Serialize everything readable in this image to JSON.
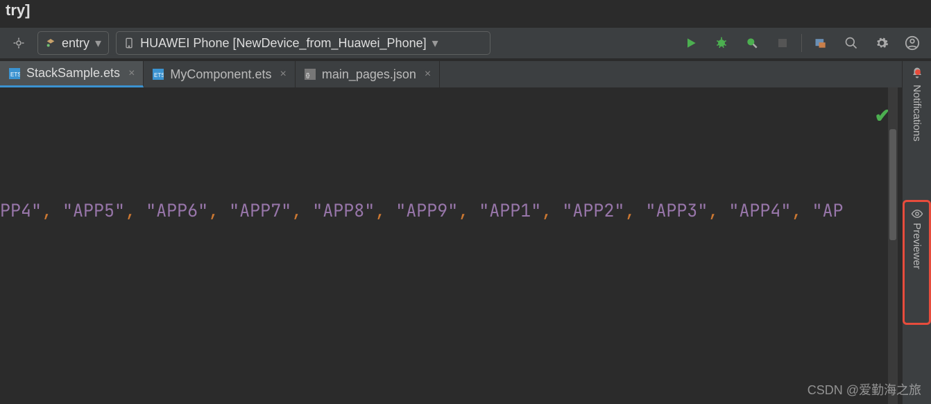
{
  "breadcrumb_fragment": "try]",
  "toolbar": {
    "module_selector": "entry",
    "device_selector": "HUAWEI Phone [NewDevice_from_Huawei_Phone]"
  },
  "tabs": [
    {
      "label": "StackSample.ets",
      "active": true
    },
    {
      "label": "MyComponent.ets",
      "active": false
    },
    {
      "label": "main_pages.json",
      "active": false
    }
  ],
  "code": {
    "tokens": [
      {
        "t": "str",
        "v": "PP4\""
      },
      {
        "t": "punc",
        "v": ","
      },
      {
        "t": "sp",
        "v": "  "
      },
      {
        "t": "str",
        "v": "\"APP5\""
      },
      {
        "t": "punc",
        "v": ","
      },
      {
        "t": "sp",
        "v": "  "
      },
      {
        "t": "str",
        "v": "\"APP6\""
      },
      {
        "t": "punc",
        "v": ","
      },
      {
        "t": "sp",
        "v": "  "
      },
      {
        "t": "str",
        "v": "\"APP7\""
      },
      {
        "t": "punc",
        "v": ","
      },
      {
        "t": "sp",
        "v": "  "
      },
      {
        "t": "str",
        "v": "\"APP8\""
      },
      {
        "t": "punc",
        "v": ","
      },
      {
        "t": "sp",
        "v": "  "
      },
      {
        "t": "str",
        "v": "\"APP9\""
      },
      {
        "t": "punc",
        "v": ","
      },
      {
        "t": "sp",
        "v": "  "
      },
      {
        "t": "str",
        "v": "\"APP1\""
      },
      {
        "t": "punc",
        "v": ","
      },
      {
        "t": "sp",
        "v": "  "
      },
      {
        "t": "str",
        "v": "\"APP2\""
      },
      {
        "t": "punc",
        "v": ","
      },
      {
        "t": "sp",
        "v": "  "
      },
      {
        "t": "str",
        "v": "\"APP3\""
      },
      {
        "t": "punc",
        "v": ","
      },
      {
        "t": "sp",
        "v": "  "
      },
      {
        "t": "str",
        "v": "\"APP4\""
      },
      {
        "t": "punc",
        "v": ","
      },
      {
        "t": "sp",
        "v": "  "
      },
      {
        "t": "str",
        "v": "\"AP"
      }
    ]
  },
  "right_sidebar": {
    "notifications_label": "Notifications",
    "previewer_label": "Previewer"
  },
  "watermark": "CSDN @爱勤海之旅"
}
